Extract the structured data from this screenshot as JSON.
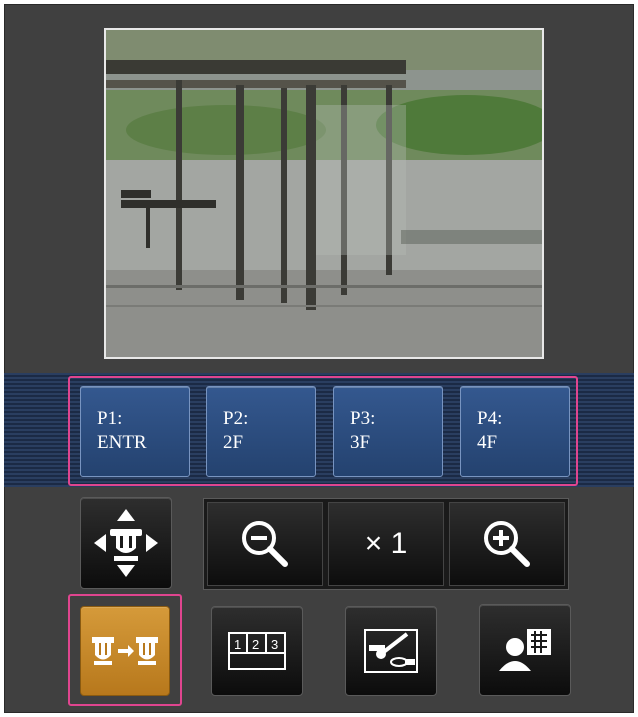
{
  "presets": [
    {
      "line1": "P1:",
      "line2": "ENTR"
    },
    {
      "line1": "P2:",
      "line2": "2F"
    },
    {
      "line1": "P3:",
      "line2": "3F"
    },
    {
      "line1": "P4:",
      "line2": "4F"
    }
  ],
  "zoom": {
    "out_icon": "zoom-out-icon",
    "level_label": "× 1",
    "in_icon": "zoom-in-icon"
  },
  "controls": {
    "pan_tilt_icon": "pan-tilt-camera-icon",
    "camera_switch_icon": "camera-switch-icon",
    "multi_screen_icon": "multi-screen-icon",
    "brightness_icon": "brightness-icon",
    "user_menu_icon": "user-screen-icon"
  },
  "multi_screen_numbers": [
    "1",
    "2",
    "3"
  ],
  "colors": {
    "highlight": "#e0458f",
    "preset_blue": "#2a4a7f",
    "active_orange": "#c58a2a"
  }
}
